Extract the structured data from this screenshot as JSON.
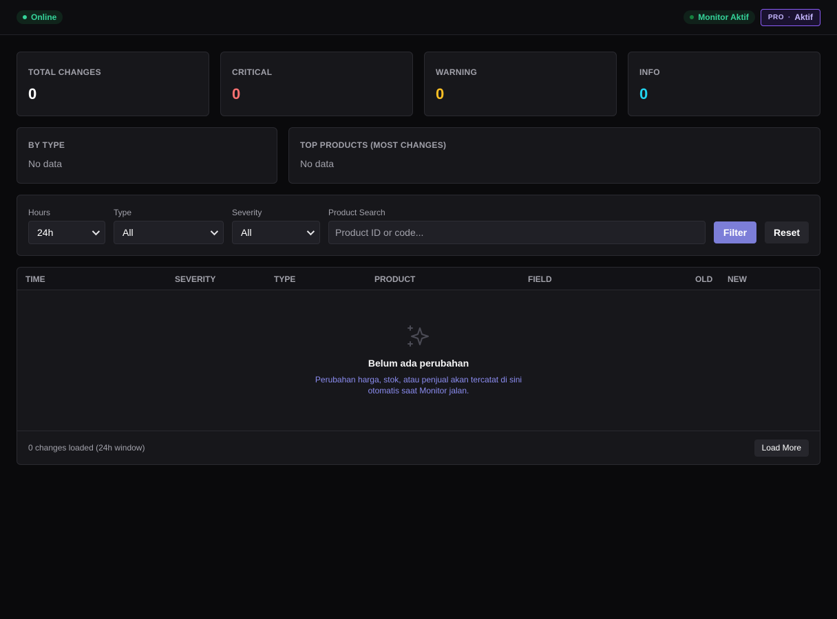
{
  "header": {
    "status": "Online",
    "monitor": "Monitor Aktif",
    "plan": "PRO",
    "plan_separator": "·",
    "plan_state": "Aktif",
    "colors": {
      "online": "#34d399",
      "pro_border": "#8b5cf6"
    }
  },
  "stats": [
    {
      "label": "TOTAL CHANGES",
      "value": "0",
      "color": "#ffffff"
    },
    {
      "label": "CRITICAL",
      "value": "0",
      "color": "#f87171"
    },
    {
      "label": "WARNING",
      "value": "0",
      "color": "#fbbf24"
    },
    {
      "label": "INFO",
      "value": "0",
      "color": "#22d3ee"
    }
  ],
  "by_type": {
    "title": "BY TYPE",
    "empty": "No data"
  },
  "top_products": {
    "title": "TOP PRODUCTS (MOST CHANGES)",
    "empty": "No data"
  },
  "filters": {
    "hours": {
      "label": "Hours",
      "value": "24h"
    },
    "type": {
      "label": "Type",
      "value": "All"
    },
    "severity": {
      "label": "Severity",
      "value": "All"
    },
    "search": {
      "label": "Product Search",
      "placeholder": "Product ID or code..."
    },
    "filter_button": "Filter",
    "reset_button": "Reset"
  },
  "table": {
    "columns": [
      "TIME",
      "SEVERITY",
      "TYPE",
      "PRODUCT",
      "FIELD",
      "OLD",
      "NEW"
    ],
    "empty_icon": "sparkles-icon",
    "empty_title": "Belum ada perubahan",
    "empty_desc": "Perubahan harga, stok, atau penjual akan tercatat di sini otomatis saat Monitor jalan.",
    "footer_text": "0 changes loaded (24h window)",
    "load_more": "Load More"
  }
}
